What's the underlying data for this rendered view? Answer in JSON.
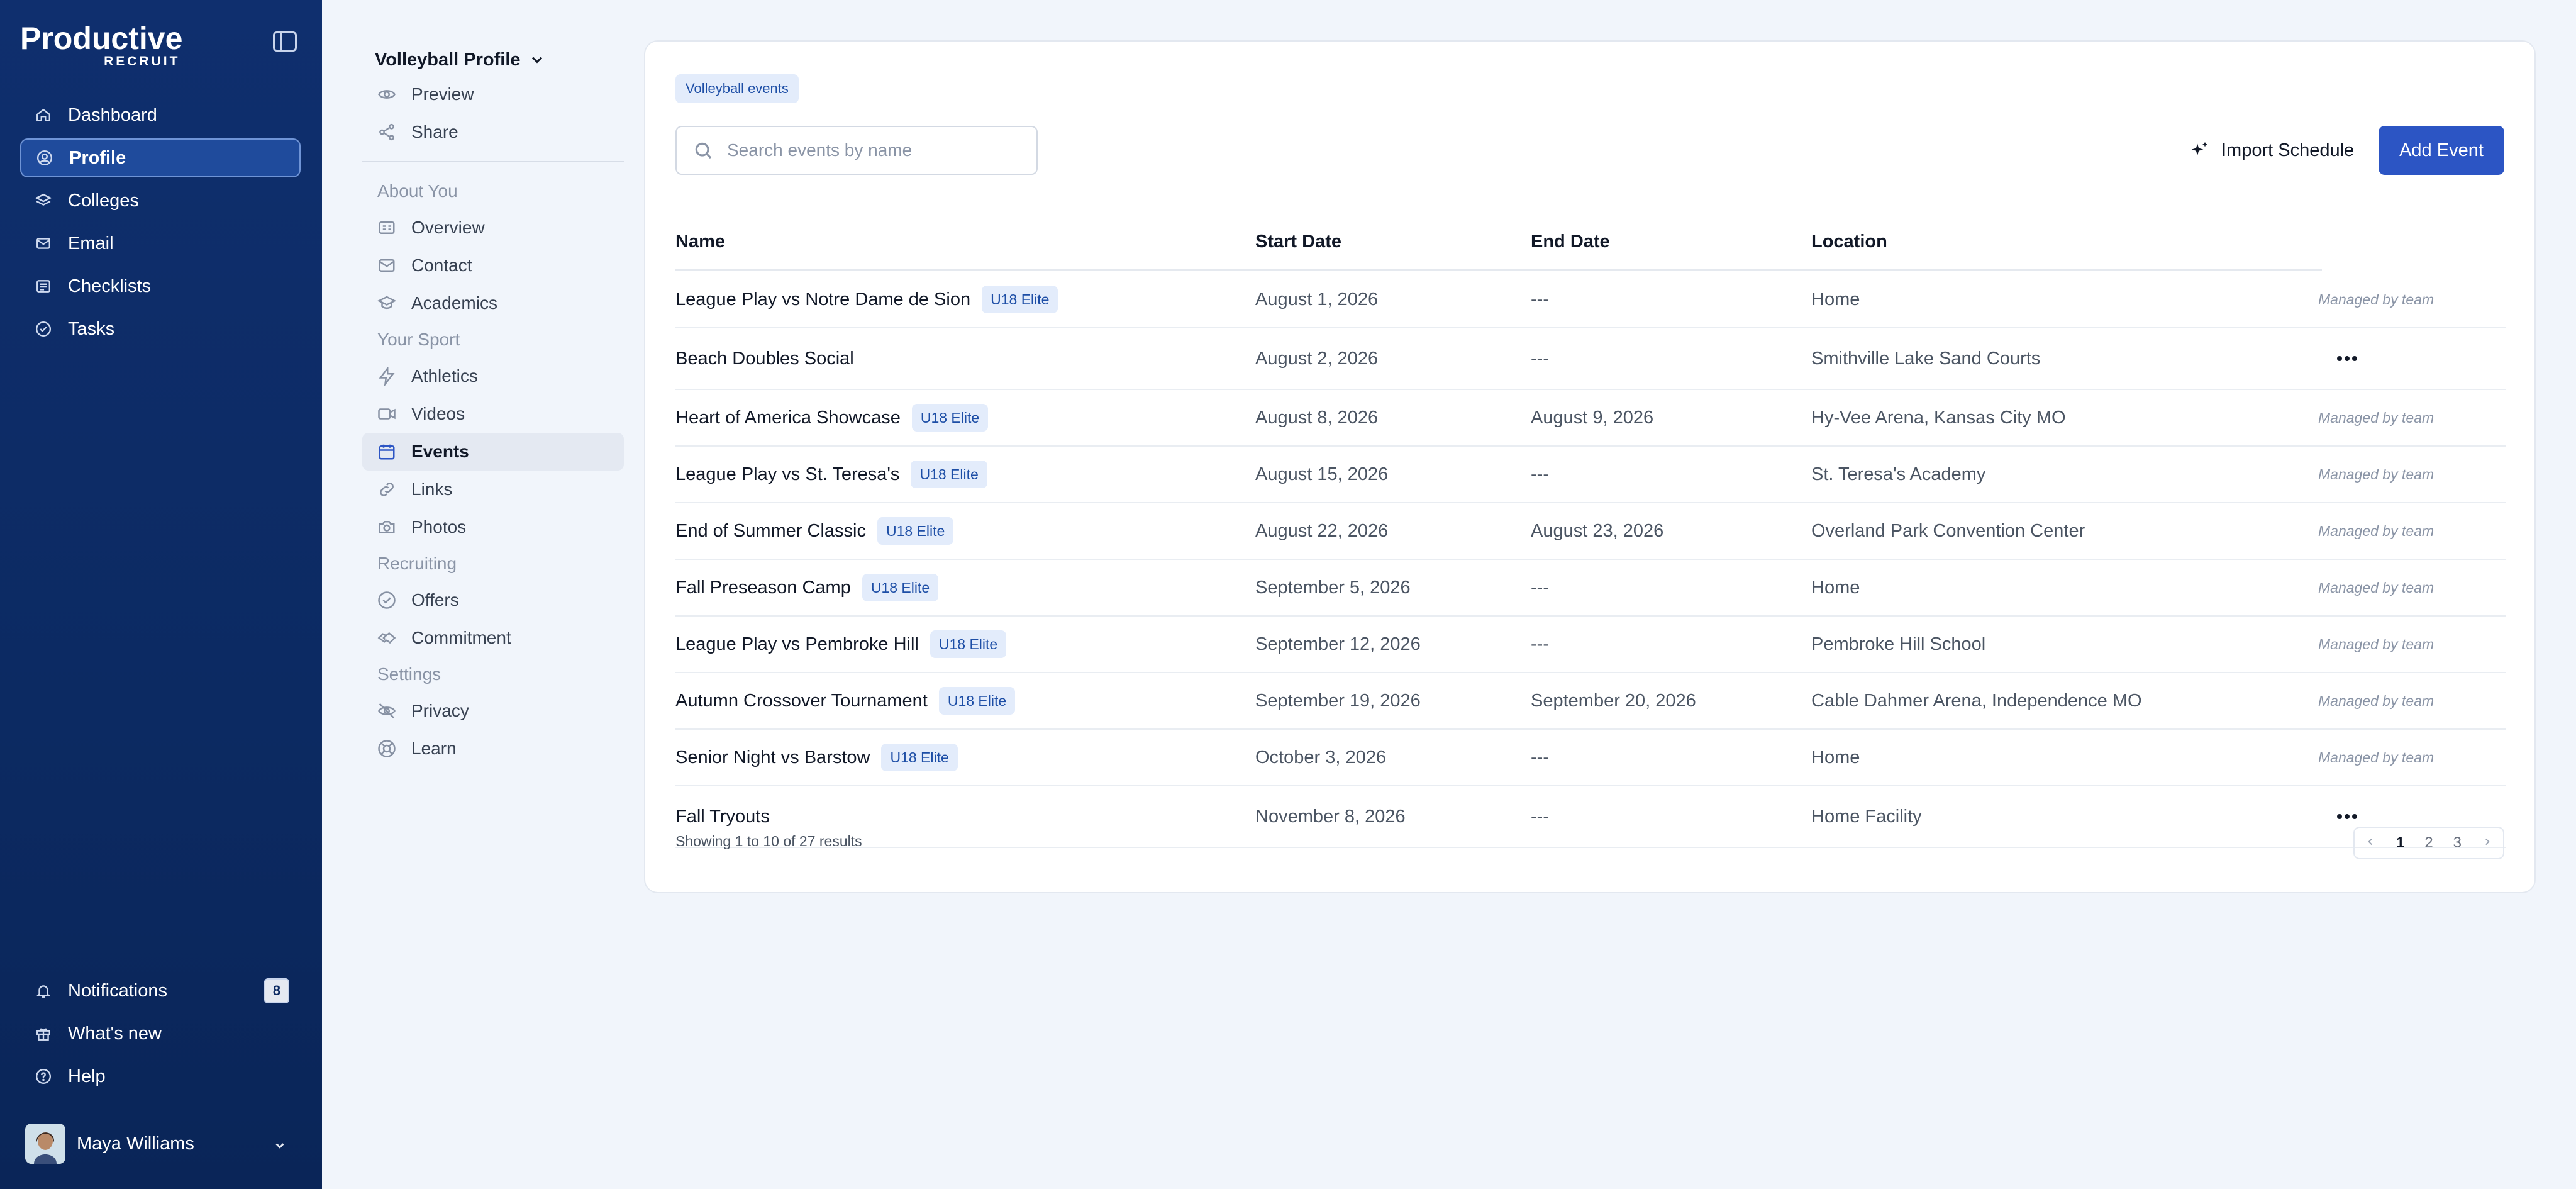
{
  "brand": {
    "line1": "Productive",
    "line2": "RECRUIT"
  },
  "nav": {
    "items": [
      {
        "label": "Dashboard"
      },
      {
        "label": "Profile"
      },
      {
        "label": "Colleges"
      },
      {
        "label": "Email"
      },
      {
        "label": "Checklists"
      },
      {
        "label": "Tasks"
      }
    ],
    "bottom": {
      "notifications": "Notifications",
      "notif_count": "8",
      "whats_new": "What's new",
      "help": "Help"
    },
    "user": {
      "name": "Maya Williams"
    }
  },
  "subnav": {
    "title": "Volleyball Profile",
    "preview": "Preview",
    "share": "Share",
    "about_header": "About You",
    "overview": "Overview",
    "contact": "Contact",
    "academics": "Academics",
    "sport_header": "Your Sport",
    "athletics": "Athletics",
    "videos": "Videos",
    "events": "Events",
    "links": "Links",
    "photos": "Photos",
    "recruiting_header": "Recruiting",
    "offers": "Offers",
    "commitment": "Commitment",
    "settings_header": "Settings",
    "privacy": "Privacy",
    "learn": "Learn"
  },
  "events": {
    "chip": "Volleyball events",
    "search_placeholder": "Search events by name",
    "import_label": "Import Schedule",
    "add_label": "Add Event",
    "columns": {
      "name": "Name",
      "start": "Start Date",
      "end": "End Date",
      "location": "Location"
    },
    "managed_text": "Managed by team",
    "rows": [
      {
        "name": "League Play vs Notre Dame de Sion",
        "badge": "U18 Elite",
        "start": "August 1, 2026",
        "end": "---",
        "location": "Home"
      },
      {
        "name": "Beach Doubles Social",
        "badge": "",
        "start": "August 2, 2026",
        "end": "---",
        "location": "Smithville Lake Sand Courts"
      },
      {
        "name": "Heart of America Showcase",
        "badge": "U18 Elite",
        "start": "August 8, 2026",
        "end": "August 9, 2026",
        "location": "Hy-Vee Arena, Kansas City MO"
      },
      {
        "name": "League Play vs St. Teresa's",
        "badge": "U18 Elite",
        "start": "August 15, 2026",
        "end": "---",
        "location": "St. Teresa's Academy"
      },
      {
        "name": "End of Summer Classic",
        "badge": "U18 Elite",
        "start": "August 22, 2026",
        "end": "August 23, 2026",
        "location": "Overland Park Convention Center"
      },
      {
        "name": "Fall Preseason Camp",
        "badge": "U18 Elite",
        "start": "September 5, 2026",
        "end": "---",
        "location": "Home"
      },
      {
        "name": "League Play vs Pembroke Hill",
        "badge": "U18 Elite",
        "start": "September 12, 2026",
        "end": "---",
        "location": "Pembroke Hill School"
      },
      {
        "name": "Autumn Crossover Tournament",
        "badge": "U18 Elite",
        "start": "September 19, 2026",
        "end": "September 20, 2026",
        "location": "Cable Dahmer Arena, Independence MO"
      },
      {
        "name": "Senior Night vs Barstow",
        "badge": "U18 Elite",
        "start": "October 3, 2026",
        "end": "---",
        "location": "Home"
      },
      {
        "name": "Fall Tryouts",
        "badge": "",
        "start": "November 8, 2026",
        "end": "---",
        "location": "Home Facility"
      }
    ],
    "footer": "Showing 1 to 10 of 27 results",
    "pages": [
      "1",
      "2",
      "3"
    ]
  }
}
